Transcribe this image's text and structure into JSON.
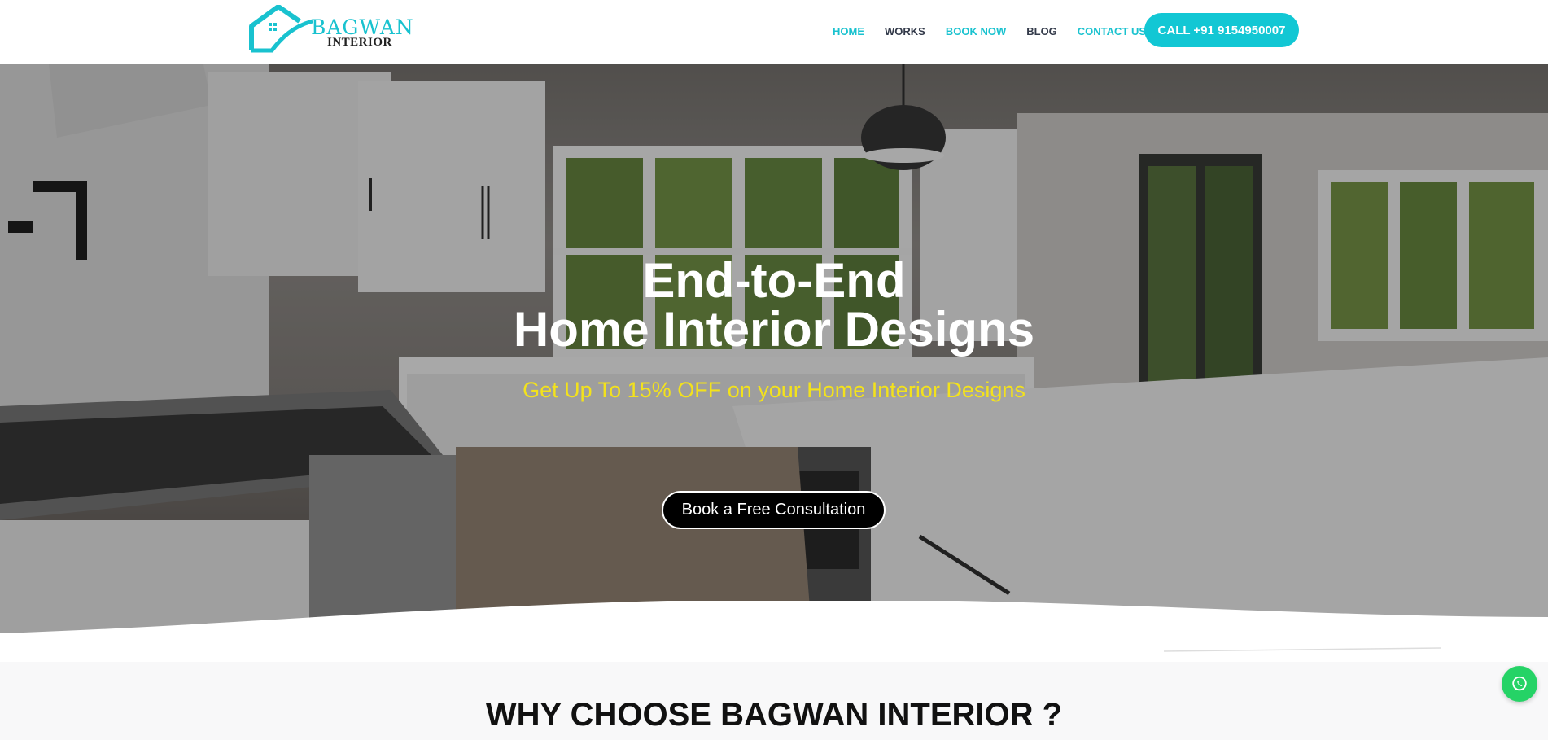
{
  "brand": {
    "name_line1": "BAGWAN",
    "name_line2": "INTERIOR"
  },
  "nav": {
    "items": [
      {
        "label": "HOME",
        "color": "#19c2cf"
      },
      {
        "label": "WORKS",
        "color": "#333a4a"
      },
      {
        "label": "BOOK NOW",
        "color": "#19c2cf"
      },
      {
        "label": "BLOG",
        "color": "#333a4a"
      },
      {
        "label": "CONTACT US",
        "color": "#19c2cf"
      }
    ],
    "call_label": "CALL +91 9154950007"
  },
  "hero": {
    "title_line1": "End-to-End",
    "title_line2": "Home Interior Designs",
    "subtitle": "Get Up To 15% OFF on your Home Interior Designs",
    "cta_label": "Book a Free Consultation"
  },
  "why": {
    "title": "WHY CHOOSE BAGWAN INTERIOR ?"
  },
  "floating": {
    "whatsapp_icon": "whatsapp-icon"
  },
  "colors": {
    "accent": "#12c7d4",
    "subtitle": "#f3e21c",
    "whatsapp": "#25d366"
  }
}
